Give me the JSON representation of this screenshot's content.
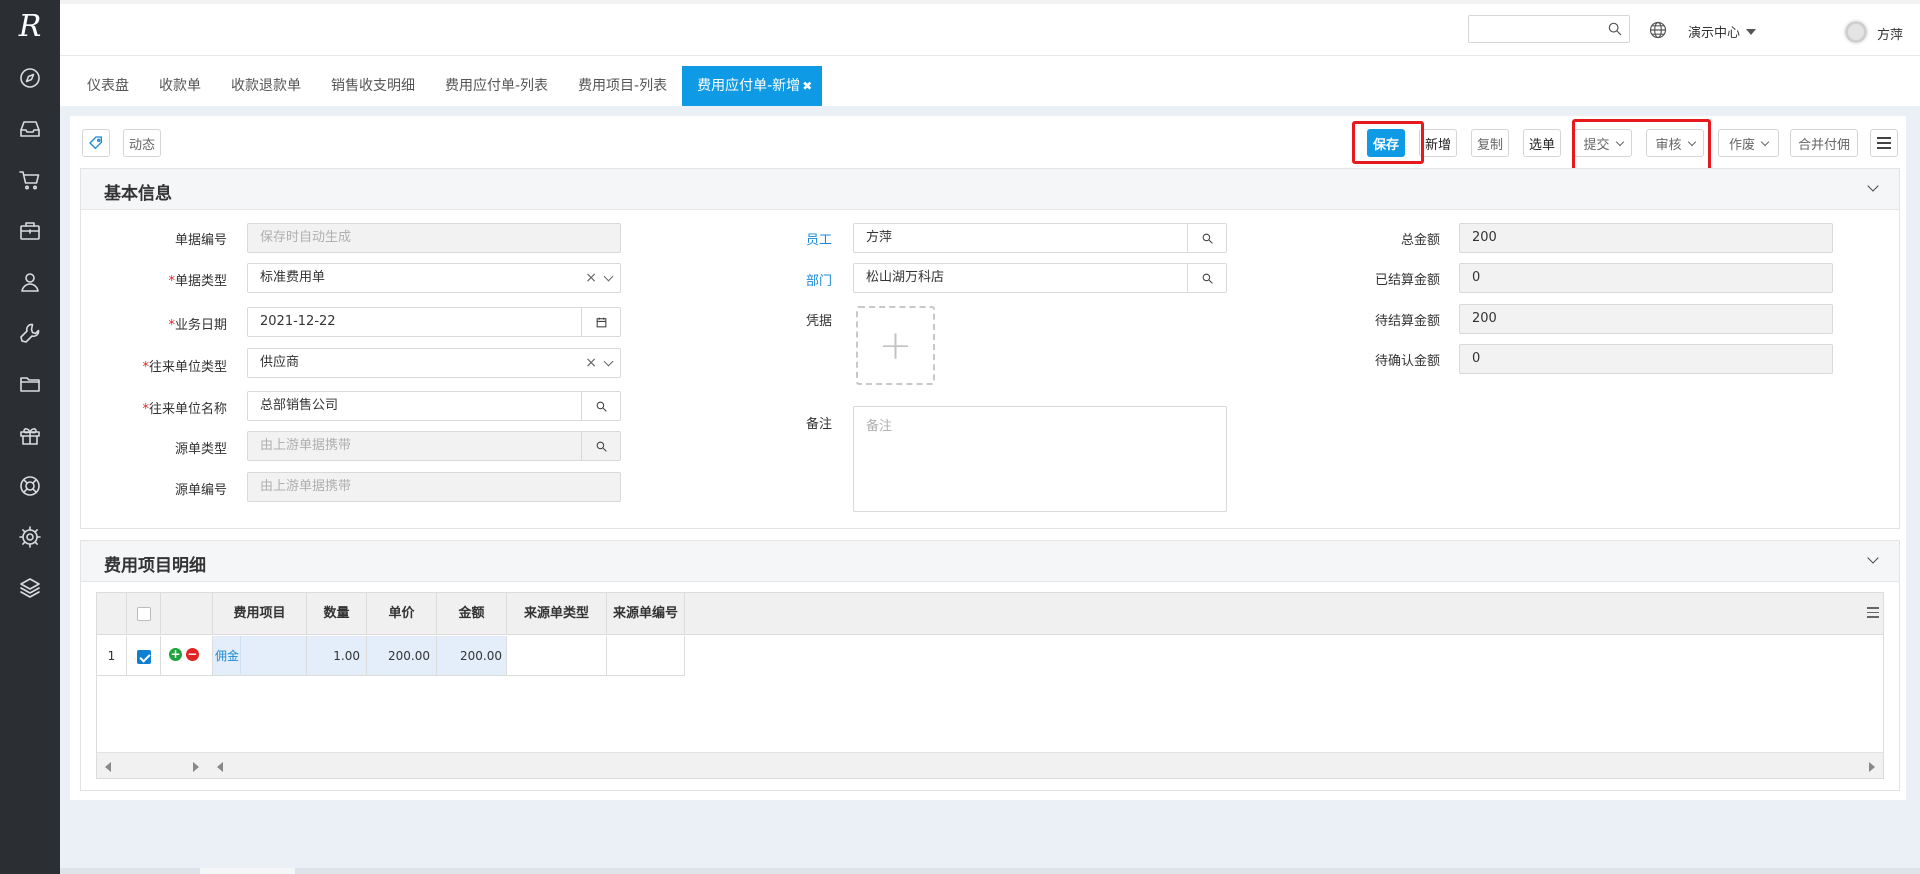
{
  "sidebar": {
    "logo": "R",
    "icons": [
      "compass-icon",
      "inbox-icon",
      "cart-icon",
      "briefcase-icon",
      "user-icon",
      "wrench-icon",
      "folder-icon",
      "gift-icon",
      "lifebuoy-icon",
      "gear-icon",
      "layers-icon"
    ]
  },
  "topbar": {
    "search_placeholder": "",
    "org": "演示中心",
    "user": "方萍",
    "help": "?"
  },
  "tabs": [
    {
      "label": "仪表盘",
      "active": false
    },
    {
      "label": "收款单",
      "active": false
    },
    {
      "label": "收款退款单",
      "active": false
    },
    {
      "label": "销售收支明细",
      "active": false
    },
    {
      "label": "费用应付单-列表",
      "active": false
    },
    {
      "label": "费用项目-列表",
      "active": false
    },
    {
      "label": "费用应付单-新增",
      "active": true,
      "close": "✖"
    }
  ],
  "toolbar": {
    "dynamic": "动态",
    "save": "保存",
    "new": "新增",
    "copy": "复制",
    "pick": "选单",
    "submit": "提交",
    "audit": "审核",
    "void": "作废",
    "merge_pay": "合并付佣"
  },
  "basic": {
    "title": "基本信息",
    "doc_no": {
      "label": "单据编号",
      "placeholder": "保存时自动生成"
    },
    "doc_type": {
      "label": "单据类型",
      "value": "标准费用单"
    },
    "biz_date": {
      "label": "业务日期",
      "value": "2021-12-22"
    },
    "partner_type": {
      "label": "往来单位类型",
      "value": "供应商"
    },
    "partner_name": {
      "label": "往来单位名称",
      "value": "总部销售公司"
    },
    "src_type": {
      "label": "源单类型",
      "placeholder": "由上游单据携带"
    },
    "src_no": {
      "label": "源单编号",
      "placeholder": "由上游单据携带"
    },
    "employee": {
      "label": "员工",
      "value": "方萍"
    },
    "dept": {
      "label": "部门",
      "value": "松山湖万科店"
    },
    "voucher": {
      "label": "凭据",
      "plus": "+"
    },
    "remark": {
      "label": "备注",
      "placeholder": "备注"
    },
    "total": {
      "label": "总金额",
      "value": "200"
    },
    "settled": {
      "label": "已结算金额",
      "value": "0"
    },
    "pending_settle": {
      "label": "待结算金额",
      "value": "200"
    },
    "pending_confirm": {
      "label": "待确认金额",
      "value": "0"
    }
  },
  "detail": {
    "title": "费用项目明细",
    "columns": [
      "费用项目",
      "数量",
      "单价",
      "金额",
      "来源单类型",
      "来源单编号"
    ],
    "rows": [
      {
        "no": "1",
        "add": "+",
        "remove": "−",
        "item": "佣金",
        "qty": "1.00",
        "price": "200.00",
        "amount": "200.00",
        "src_type": "",
        "src_no": ""
      }
    ]
  },
  "colors": {
    "accent": "#0e9ae5",
    "sidebar": "#2b2f33",
    "highlight": "#e8191c",
    "link": "#1a8ad8"
  }
}
